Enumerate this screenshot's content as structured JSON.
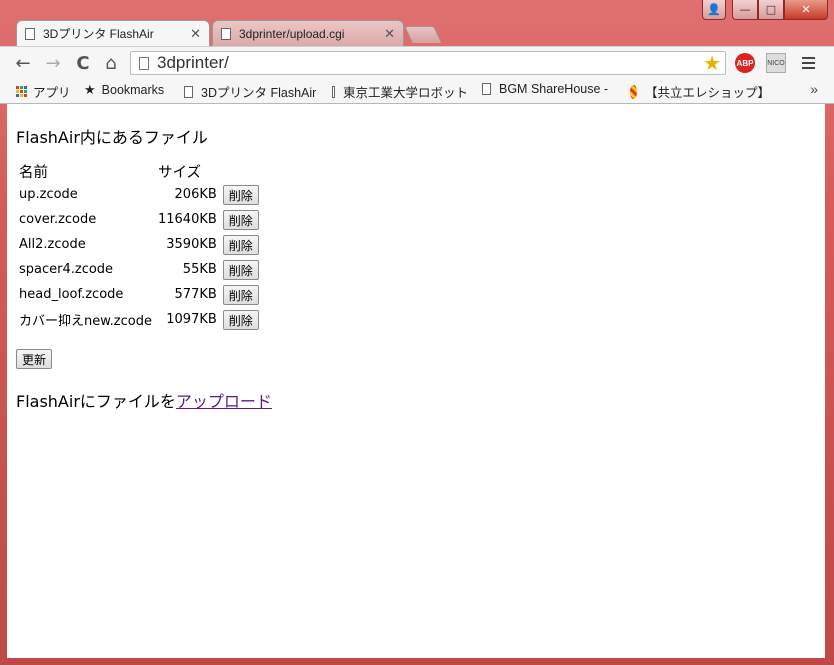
{
  "window": {
    "controls": {
      "user": "👤",
      "minimize": "—",
      "maximize": "□",
      "close": "✕"
    }
  },
  "tabs": [
    {
      "title": "3Dプリンタ FlashAir",
      "active": true
    },
    {
      "title": "3dprinter/upload.cgi",
      "active": false
    }
  ],
  "toolbar": {
    "back_icon": "←",
    "forward_icon": "→",
    "reload_icon": "C",
    "home_icon": "⌂",
    "url": "3dprinter/",
    "star_icon": "★",
    "abp_label": "ABP",
    "nico_label": "NICO"
  },
  "bookmarks": {
    "apps": "アプリ",
    "bookmarks": "Bookmarks",
    "items": [
      "3Dプリンタ FlashAir",
      "東京工業大学ロボット",
      "BGM ShareHouse -",
      "【共立エレショップ】"
    ],
    "more": "»"
  },
  "page": {
    "heading": "FlashAir内にあるファイル",
    "columns": {
      "name": "名前",
      "size": "サイズ"
    },
    "files": [
      {
        "name": "up.zcode",
        "size": "206KB",
        "delete": "削除"
      },
      {
        "name": "cover.zcode",
        "size": "11640KB",
        "delete": "削除"
      },
      {
        "name": "All2.zcode",
        "size": "3590KB",
        "delete": "削除"
      },
      {
        "name": "spacer4.zcode",
        "size": "55KB",
        "delete": "削除"
      },
      {
        "name": "head_loof.zcode",
        "size": "577KB",
        "delete": "削除"
      },
      {
        "name": "カバー抑えnew.zcode",
        "size": "1097KB",
        "delete": "削除"
      }
    ],
    "refresh": "更新",
    "upload_prefix": "FlashAirにファイルを",
    "upload_link": "アップロード"
  }
}
